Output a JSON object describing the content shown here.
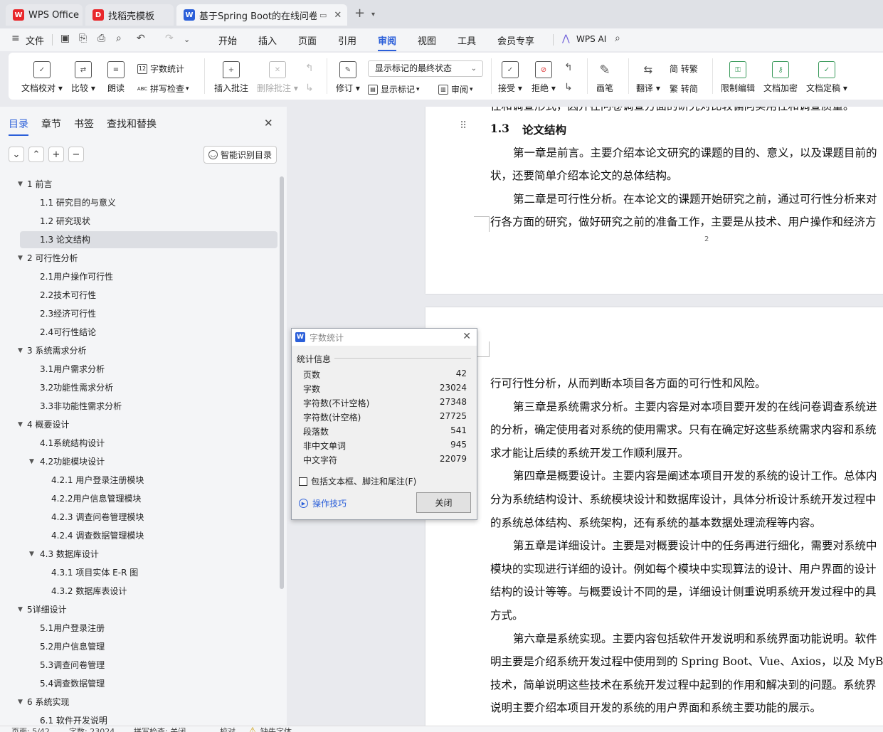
{
  "tabs": [
    {
      "label": "WPS Office",
      "color": "#e8272b",
      "logo": "W"
    },
    {
      "label": "找稻壳模板",
      "color": "#e8272b",
      "logo": "D"
    },
    {
      "label": "基于Spring Boot的在线问卷",
      "color": "#2b5fd9",
      "logo": "W"
    }
  ],
  "menu": {
    "file": "文件",
    "items": [
      "开始",
      "插入",
      "页面",
      "引用",
      "审阅",
      "视图",
      "工具",
      "会员专享"
    ],
    "active": "审阅",
    "wps_ai": "WPS AI"
  },
  "ribbon": {
    "doc_check": "文档校对",
    "compare": "比较",
    "read_aloud": "朗读",
    "word_count": "字数统计",
    "spell_check": "拼写检查",
    "insert_comment": "插入批注",
    "delete_comment": "删除批注",
    "revise": "修订",
    "markup_state": "显示标记的最终状态",
    "show_markup": "显示标记",
    "review_pane": "审阅",
    "accept": "接受",
    "reject": "拒绝",
    "pen": "画笔",
    "translate": "翻译",
    "to_traditional": "简 转繁",
    "to_simplified": "繁 转简",
    "restrict_edit": "限制编辑",
    "doc_encrypt": "文档加密",
    "doc_finalize": "文档定稿"
  },
  "sidebar": {
    "tabs": [
      "目录",
      "章节",
      "书签",
      "查找和替换"
    ],
    "smart_btn": "智能识别目录",
    "toc": [
      {
        "label": "1   前言",
        "level": 0,
        "expanded": true
      },
      {
        "label": "1.1   研究目的与意义",
        "level": 1
      },
      {
        "label": "1.2   研究现状",
        "level": 1
      },
      {
        "label": "1.3   论文结构",
        "level": 1,
        "selected": true
      },
      {
        "label": "2   可行性分析",
        "level": 0,
        "expanded": true
      },
      {
        "label": "2.1用户操作可行性",
        "level": 1
      },
      {
        "label": "2.2技术可行性",
        "level": 1
      },
      {
        "label": "2.3经济可行性",
        "level": 1
      },
      {
        "label": "2.4可行性结论",
        "level": 1
      },
      {
        "label": "3   系统需求分析",
        "level": 0,
        "expanded": true
      },
      {
        "label": "3.1用户需求分析",
        "level": 1
      },
      {
        "label": "3.2功能性需求分析",
        "level": 1
      },
      {
        "label": "3.3非功能性需求分析",
        "level": 1
      },
      {
        "label": "4   概要设计",
        "level": 0,
        "expanded": true
      },
      {
        "label": "4.1系统结构设计",
        "level": 1
      },
      {
        "label": "4.2功能模块设计",
        "level": 1,
        "expanded": true,
        "subparent": true
      },
      {
        "label": "4.2.1  用户登录注册模块",
        "level": 2
      },
      {
        "label": "4.2.2用户信息管理模块",
        "level": 2
      },
      {
        "label": "4.2.3  调查问卷管理模块",
        "level": 2
      },
      {
        "label": "4.2.4  调查数据管理模块",
        "level": 2
      },
      {
        "label": "4.3    数据库设计",
        "level": 1,
        "expanded": true,
        "subparent": true
      },
      {
        "label": "4.3.1    项目实体 E-R 图",
        "level": 2
      },
      {
        "label": "4.3.2    数据库表设计",
        "level": 2
      },
      {
        "label": "5详细设计",
        "level": 0,
        "expanded": true
      },
      {
        "label": "5.1用户登录注册",
        "level": 1
      },
      {
        "label": "5.2用户信息管理",
        "level": 1
      },
      {
        "label": "5.3调查问卷管理",
        "level": 1
      },
      {
        "label": "5.4调查数据管理",
        "level": 1
      },
      {
        "label": "6   系统实现",
        "level": 0,
        "expanded": true
      },
      {
        "label": "6.1   软件开发说明",
        "level": 1,
        "subparent": true
      }
    ]
  },
  "doc": {
    "page1_top": "往和调查形式，因并在问卷调查方面的研究对比较偏向实用性和调查质量。",
    "heading_num": "1.3",
    "heading_text": "论文结构",
    "p1_l1": "第一章是前言。主要介绍本论文研究的课题的目的、意义，以及课题目前的",
    "p1_l2": "状，还要简单介绍本论文的总体结构。",
    "p2_l1": "第二章是可行性分析。在本论文的课题开始研究之前，通过可行性分析来对",
    "p2_l2": "行各方面的研究，做好研究之前的准备工作，主要是从技术、用户操作和经济方",
    "page_number": "2",
    "lines": [
      {
        "t": "行可行性分析，从而判断本项目各方面的可行性和风险。",
        "indent": false
      },
      {
        "t": "第三章是系统需求分析。主要内容是对本项目要开发的在线问卷调查系统进",
        "indent": true
      },
      {
        "t": "的分析，确定使用者对系统的使用需求。只有在确定好这些系统需求内容和系统",
        "indent": false
      },
      {
        "t": "求才能让后续的系统开发工作顺利展开。",
        "indent": false
      },
      {
        "t": "第四章是概要设计。主要内容是阐述本项目开发的系统的设计工作。总体内",
        "indent": true
      },
      {
        "t": "分为系统结构设计、系统模块设计和数据库设计，具体分析设计系统开发过程中",
        "indent": false
      },
      {
        "t": "的系统总体结构、系统架构，还有系统的基本数据处理流程等内容。",
        "indent": false
      },
      {
        "t": "第五章是详细设计。主要是对概要设计中的任务再进行细化，需要对系统中",
        "indent": true
      },
      {
        "t": "模块的实现进行详细的设计。例如每个模块中实现算法的设计、用户界面的设计",
        "indent": false
      },
      {
        "t": "结构的设计等等。与概要设计不同的是，详细设计侧重说明系统开发过程中的具",
        "indent": false
      },
      {
        "t": "方式。",
        "indent": false
      },
      {
        "t": "第六章是系统实现。主要内容包括软件开发说明和系统界面功能说明。软件",
        "indent": true
      },
      {
        "t": "明主要是介绍系统开发过程中使用到的 Spring Boot、Vue、Axios，以及 MyBatis",
        "indent": false
      },
      {
        "t": "技术，简单说明这些技术在系统开发过程中起到的作用和解决到的问题。系统界",
        "indent": false
      },
      {
        "t": "说明主要介绍本项目开发的系统的用户界面和系统主要功能的展示。",
        "indent": false
      }
    ]
  },
  "dialog": {
    "title": "字数统计",
    "group": "统计信息",
    "rows": [
      {
        "k": "页数",
        "v": "42"
      },
      {
        "k": "字数",
        "v": "23024"
      },
      {
        "k": "字符数(不计空格)",
        "v": "27348"
      },
      {
        "k": "字符数(计空格)",
        "v": "27725"
      },
      {
        "k": "段落数",
        "v": "541"
      },
      {
        "k": "非中文单词",
        "v": "945"
      },
      {
        "k": "中文字符",
        "v": "22079"
      }
    ],
    "checkbox": "包括文本框、脚注和尾注(F)",
    "tips": "操作技巧",
    "close": "关闭"
  },
  "status": {
    "page": "页面: 5/42",
    "words": "字数: 23024",
    "spell": "拼写检查: 关闭",
    "proof": "校对",
    "missing_font": "缺失字体"
  },
  "colors": {
    "accent": "#2b5fd9",
    "wps_red": "#e8272b"
  }
}
